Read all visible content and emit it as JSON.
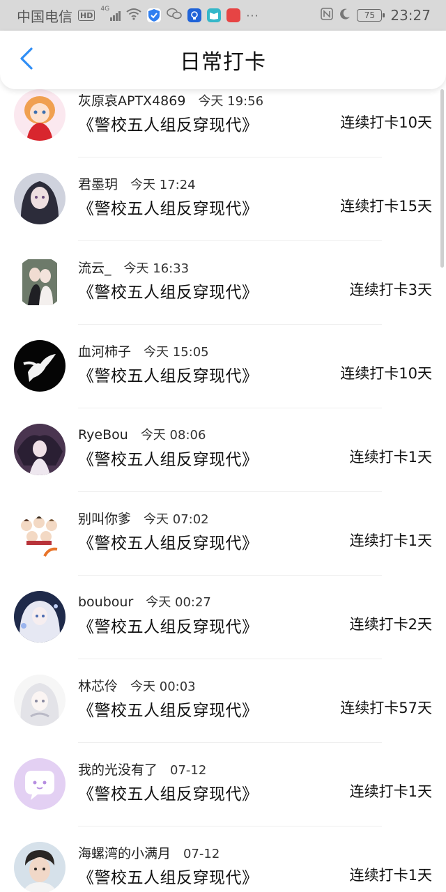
{
  "status_bar": {
    "carrier": "中国电信",
    "hd": "HD",
    "network": "4G",
    "battery": "75",
    "time": "23:27"
  },
  "header": {
    "title": "日常打卡",
    "back_icon": "chevron-left-icon",
    "accent_color": "#2f8ef5"
  },
  "entries": [
    {
      "username": "灰原哀APTX4869",
      "time": "今天 19:56",
      "book": "《警校五人组反穿现代》",
      "streak": "连续打卡10天"
    },
    {
      "username": "君墨玥",
      "time": "今天 17:24",
      "book": "《警校五人组反穿现代》",
      "streak": "连续打卡15天"
    },
    {
      "username": "流云_",
      "time": "今天 16:33",
      "book": "《警校五人组反穿现代》",
      "streak": "连续打卡3天"
    },
    {
      "username": "血河柿子",
      "time": "今天 15:05",
      "book": "《警校五人组反穿现代》",
      "streak": "连续打卡10天"
    },
    {
      "username": "RyeBou",
      "time": "今天 08:06",
      "book": "《警校五人组反穿现代》",
      "streak": "连续打卡1天"
    },
    {
      "username": "别叫你爹",
      "time": "今天 07:02",
      "book": "《警校五人组反穿现代》",
      "streak": "连续打卡1天"
    },
    {
      "username": "boubour",
      "time": "今天 00:27",
      "book": "《警校五人组反穿现代》",
      "streak": "连续打卡2天"
    },
    {
      "username": "林芯伶",
      "time": "今天 00:03",
      "book": "《警校五人组反穿现代》",
      "streak": "连续打卡57天"
    },
    {
      "username": "我的光没有了",
      "time": "07-12",
      "book": "《警校五人组反穿现代》",
      "streak": "连续打卡1天"
    },
    {
      "username": "海螺湾的小满月",
      "time": "07-12",
      "book": "《警校五人组反穿现代》",
      "streak": "连续打卡1天"
    }
  ]
}
